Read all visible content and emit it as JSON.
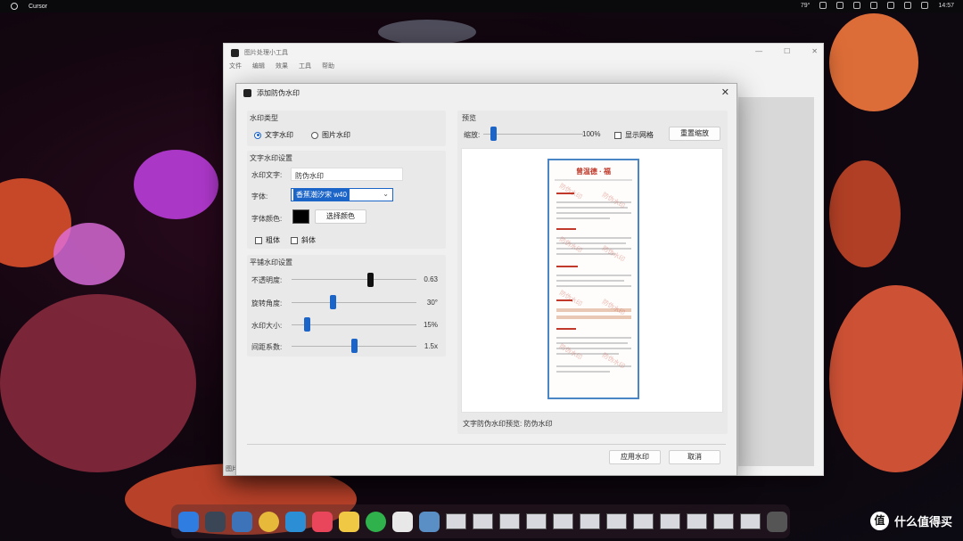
{
  "topbar": {
    "app_name": "Cursor",
    "weather": "79°",
    "time": "14:57"
  },
  "main_window": {
    "title": "图片处理小工具",
    "menu": [
      "文件",
      "编辑",
      "效果",
      "工具",
      "帮助"
    ],
    "status_stub": "图片"
  },
  "dialog": {
    "title": "添加防伪水印",
    "watermark_type": {
      "label": "水印类型",
      "options": [
        "文字水印",
        "图片水印"
      ],
      "selected": "文字水印"
    },
    "text_settings": {
      "label": "文字水印设置",
      "text_label": "水印文字:",
      "text_value": "防伪水印",
      "font_label": "字体:",
      "font_value": "香蕉潮汐宋 w40",
      "color_label": "字体颜色:",
      "color_value": "#000000",
      "choose_color_button": "选择颜色",
      "bold_label": "粗体",
      "italic_label": "斜体"
    },
    "tile_settings": {
      "label": "平铺水印设置",
      "sliders": [
        {
          "label": "不透明度:",
          "value_text": "0.63",
          "fraction": 0.63
        },
        {
          "label": "旋转角度:",
          "value_text": "30°",
          "fraction": 0.33
        },
        {
          "label": "水印大小:",
          "value_text": "15%",
          "fraction": 0.12
        },
        {
          "label": "间距系数:",
          "value_text": "1.5x",
          "fraction": 0.5
        }
      ]
    },
    "preview": {
      "label": "预览",
      "zoom_label": "缩放:",
      "zoom_value": "100%",
      "zoom_fraction": 0.1,
      "show_grid_label": "显示网格",
      "reset_zoom_button": "重置缩放",
      "doc_title": "曾温德 · 福",
      "watermark_text": "防伪水印",
      "status": "文字防伪水印预览: 防伪水印"
    },
    "apply_button": "应用水印",
    "cancel_button": "取消"
  },
  "brand": {
    "text": "什么值得买",
    "logo_glyph": "值"
  }
}
